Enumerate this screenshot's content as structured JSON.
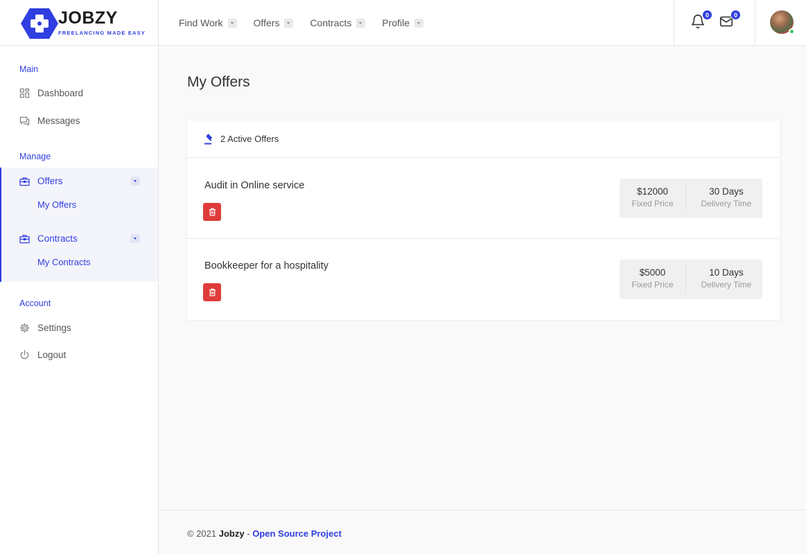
{
  "brand": {
    "name": "JOBZY",
    "tagline": "FREELANCING MADE EASY"
  },
  "nav": [
    {
      "label": "Find Work"
    },
    {
      "label": "Offers"
    },
    {
      "label": "Contracts"
    },
    {
      "label": "Profile"
    }
  ],
  "header": {
    "notifications_count": "0",
    "messages_count": "0"
  },
  "sidebar": {
    "main_label": "Main",
    "dashboard": "Dashboard",
    "messages": "Messages",
    "manage_label": "Manage",
    "offers": "Offers",
    "my_offers": "My Offers",
    "contracts": "Contracts",
    "my_contracts": "My Contracts",
    "account_label": "Account",
    "settings": "Settings",
    "logout": "Logout"
  },
  "page": {
    "title": "My Offers",
    "active_offers": "2 Active Offers",
    "offers": [
      {
        "title": "Audit in Online service",
        "price": "$12000",
        "price_label": "Fixed Price",
        "delivery": "30 Days",
        "delivery_label": "Delivery Time"
      },
      {
        "title": "Bookkeeper for a hospitality",
        "price": "$5000",
        "price_label": "Fixed Price",
        "delivery": "10 Days",
        "delivery_label": "Delivery Time"
      }
    ]
  },
  "footer": {
    "copyright": "© 2021",
    "brand": "Jobzy",
    "separator": "-",
    "link": "Open Source Project"
  },
  "colors": {
    "accent": "#2f3ee0",
    "danger": "#e03b3b",
    "online": "#3cc45a"
  }
}
